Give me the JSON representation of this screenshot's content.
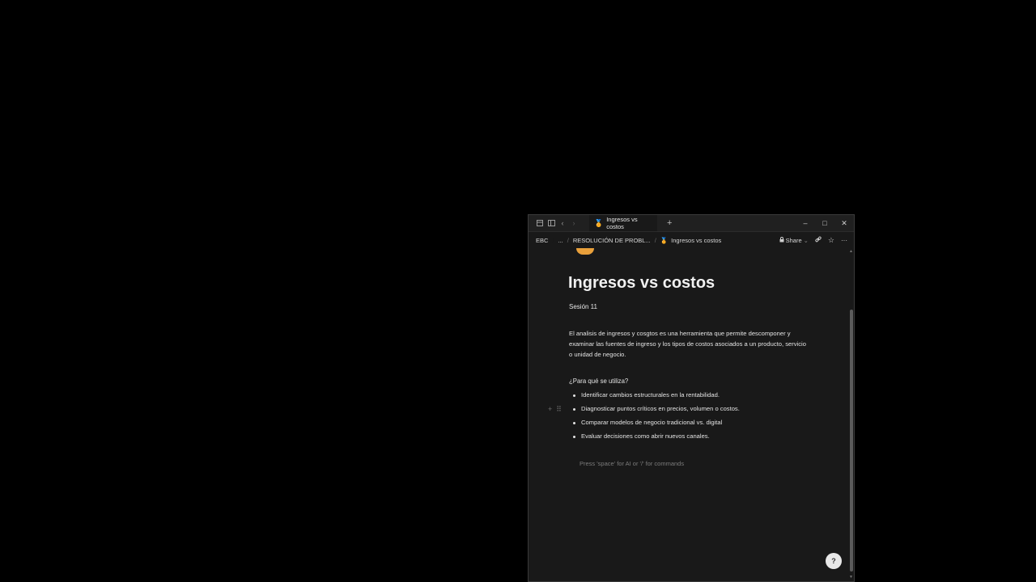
{
  "browser": {
    "tab_title": "Ingresos vs costos",
    "new_tab": "+",
    "icons": [
      "tabs-icon",
      "sidebar-icon",
      "back-icon",
      "forward-icon"
    ],
    "window_controls": {
      "minimize": "–",
      "maximize": "□",
      "close": "✕"
    }
  },
  "breadcrumb": {
    "root": "EBC",
    "ellipsis": "...",
    "parent": "RESOLUCIÓN DE PROBL...",
    "separator": "/",
    "current": "Ingresos vs costos"
  },
  "toolbar": {
    "share_label": "Share",
    "share_caret": "⌄",
    "lock_glyph": "🔒",
    "link_glyph": "🔗",
    "star_glyph": "☆",
    "more_glyph": "···"
  },
  "page": {
    "title": "Ingresos vs costos",
    "subtitle": "Sesión 11",
    "paragraph": "El analisis de ingresos y cosgtos es una herramienta que permite descomponer y examinar las fuentes de ingreso y los tipos de costos asociados a un producto, servicio o unidad de negocio.",
    "question": "¿Para qué se utiliza?",
    "bullets": [
      "Identificar cambios estructurales en la rentabilidad.",
      "Diagnosticar puntos críticos en precios, volumen o costos.",
      "Comparar modelos de negocio tradicional vs. digital",
      "Evaluar decisiones como abrir nuevos canales."
    ],
    "placeholder": "Press 'space' for AI or '/' for commands",
    "block_handle": {
      "add": "+",
      "drag": "⠿"
    }
  },
  "help": {
    "label": "?"
  },
  "colors": {
    "accent": "#e9a03b",
    "background": "#191919"
  }
}
